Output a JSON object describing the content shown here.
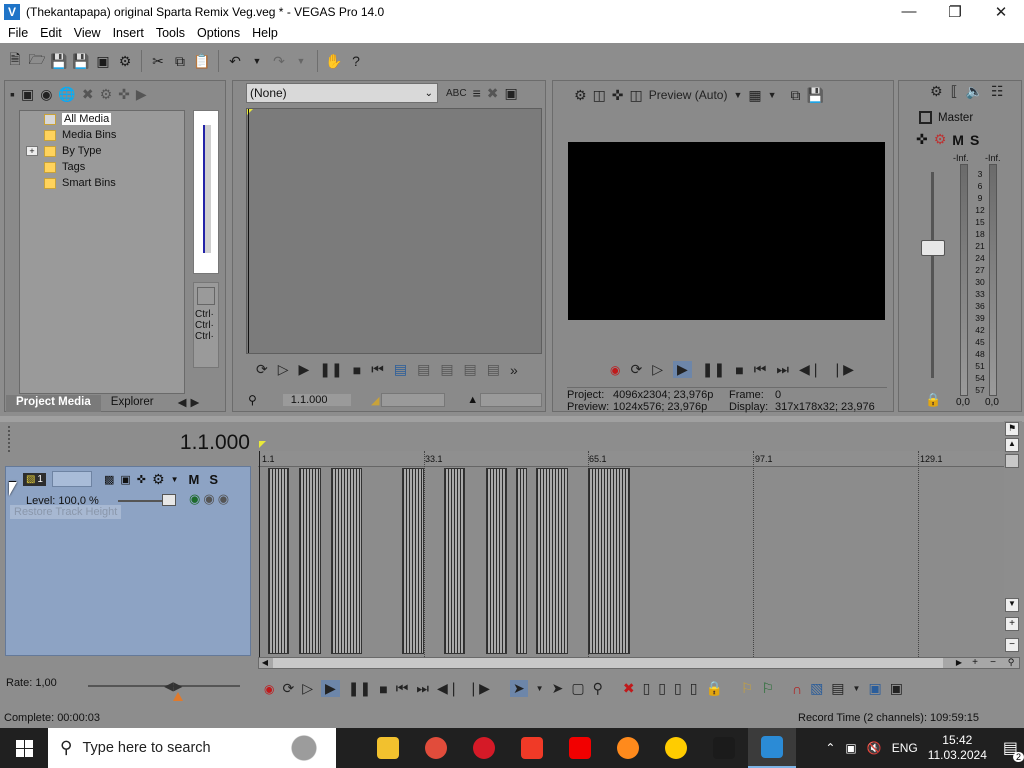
{
  "window": {
    "title": "(Thekantapapa) original Sparta Remix Veg.veg * - VEGAS Pro 14.0",
    "app_icon": "vegas-logo-icon"
  },
  "menu": [
    "File",
    "Edit",
    "View",
    "Insert",
    "Tools",
    "Options",
    "Help"
  ],
  "project_media": {
    "tree": [
      {
        "label": "All Media",
        "expandable": false
      },
      {
        "label": "Media Bins",
        "expandable": false
      },
      {
        "label": "By Type",
        "expandable": true,
        "expander": "+"
      },
      {
        "label": "Tags",
        "expandable": false
      },
      {
        "label": "Smart Bins",
        "expandable": false
      }
    ],
    "shortcuts": [
      "Ctrl·",
      "Ctrl·",
      "Ctrl·"
    ],
    "tabs": [
      "Project Media",
      "Explorer"
    ]
  },
  "trimmer": {
    "select_value": "(None)",
    "timecode": "1.1.000"
  },
  "preview": {
    "mode": "Preview (Auto)",
    "project_label": "Project:",
    "project_value": "4096x2304; 23,976p",
    "preview_label": "Preview:",
    "preview_value": "1024x576; 23,976p",
    "frame_label": "Frame:",
    "frame_value": "0",
    "display_label": "Display:",
    "display_value": "317x178x32; 23,976"
  },
  "master": {
    "title": "Master",
    "m_label": "M",
    "s_label": "S",
    "inf_left": "-Inf.",
    "inf_right": "-Inf.",
    "scale": [
      "3",
      "6",
      "9",
      "12",
      "15",
      "18",
      "21",
      "24",
      "27",
      "30",
      "33",
      "36",
      "39",
      "42",
      "45",
      "48",
      "51",
      "54",
      "57"
    ],
    "value_left": "0,0",
    "value_right": "0,0"
  },
  "timeline": {
    "time": "1.1.000",
    "ruler": [
      "1.1",
      "33.1",
      "65.1",
      "97.1",
      "129.1"
    ],
    "track_number": "1",
    "m_label": "M",
    "s_label": "S",
    "level": "Level: 100,0 %",
    "tooltip": "Restore Track Height",
    "rate": "Rate: 1,00"
  },
  "status": {
    "complete": "Complete: 00:00:03",
    "record_time": "Record Time (2 channels): 109:59:15"
  },
  "taskbar": {
    "search_placeholder": "Type here to search",
    "lang": "ENG",
    "time": "15:42",
    "date": "11.03.2024",
    "notification_count": "2",
    "apps": [
      {
        "name": "file-explorer-icon",
        "color": "#f2c12e"
      },
      {
        "name": "chrome-icon",
        "color": "#e14c3b"
      },
      {
        "name": "opera-icon",
        "color": "#d51a27"
      },
      {
        "name": "yandex-icon",
        "color": "#f03a27"
      },
      {
        "name": "youtube-icon",
        "color": "#f20000"
      },
      {
        "name": "firefox-icon",
        "color": "#ff8a1c"
      },
      {
        "name": "yandex-browser-icon",
        "color": "#ffcc00"
      },
      {
        "name": "7zip-icon",
        "color": "#1b1b1b"
      },
      {
        "name": "vegas-taskbar-icon",
        "color": "#2b8bd6"
      }
    ]
  }
}
